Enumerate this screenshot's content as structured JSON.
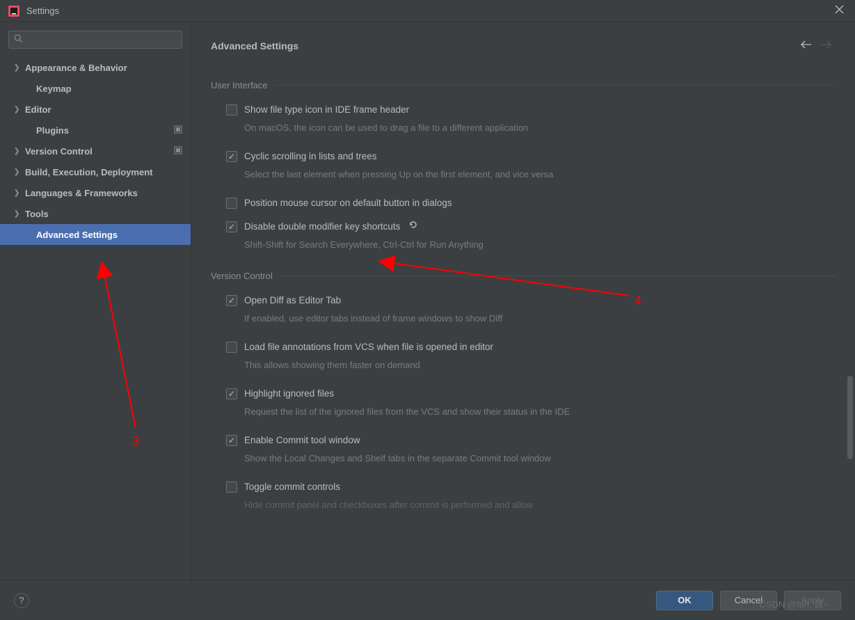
{
  "window": {
    "title": "Settings"
  },
  "sidebar": {
    "search_placeholder": "",
    "items": [
      {
        "label": "Appearance & Behavior",
        "expandable": true
      },
      {
        "label": "Keymap",
        "expandable": false
      },
      {
        "label": "Editor",
        "expandable": true
      },
      {
        "label": "Plugins",
        "expandable": false,
        "badge": true
      },
      {
        "label": "Version Control",
        "expandable": true,
        "badge": true
      },
      {
        "label": "Build, Execution, Deployment",
        "expandable": true
      },
      {
        "label": "Languages & Frameworks",
        "expandable": true
      },
      {
        "label": "Tools",
        "expandable": true
      },
      {
        "label": "Advanced Settings",
        "expandable": false,
        "selected": true
      }
    ]
  },
  "main": {
    "title": "Advanced Settings",
    "sections": [
      {
        "title": "User Interface",
        "options": [
          {
            "checked": false,
            "label": "Show file type icon in IDE frame header",
            "desc": "On macOS, the icon can be used to drag a file to a different application"
          },
          {
            "checked": true,
            "label": "Cyclic scrolling in lists and trees",
            "desc": "Select the last element when pressing Up on the first element, and vice versa"
          },
          {
            "checked": false,
            "label": "Position mouse cursor on default button in dialogs",
            "desc": ""
          },
          {
            "checked": true,
            "label": "Disable double modifier key shortcuts",
            "desc": "Shift-Shift for Search Everywhere, Ctrl-Ctrl for Run Anything",
            "reset": true
          }
        ]
      },
      {
        "title": "Version Control",
        "options": [
          {
            "checked": true,
            "label": "Open Diff as Editor Tab",
            "desc": "If enabled, use editor tabs instead of frame windows to show Diff"
          },
          {
            "checked": false,
            "label": "Load file annotations from VCS when file is opened in editor",
            "desc": "This allows showing them faster on demand"
          },
          {
            "checked": true,
            "label": "Highlight ignored files",
            "desc": "Request the list of the ignored files from the VCS and show their status in the IDE"
          },
          {
            "checked": true,
            "label": "Enable Commit tool window",
            "desc": "Show the Local Changes and Shelf tabs in the separate Commit tool window"
          },
          {
            "checked": false,
            "label": "Toggle commit controls",
            "desc": "Hide commit panel and checkboxes after commit is performed and allow"
          }
        ]
      }
    ]
  },
  "footer": {
    "ok": "OK",
    "cancel": "Cancel",
    "apply": "Apply"
  },
  "annotations": {
    "label_3": "3",
    "label_4": "4"
  },
  "watermark": "CSDN @fun.   远~"
}
